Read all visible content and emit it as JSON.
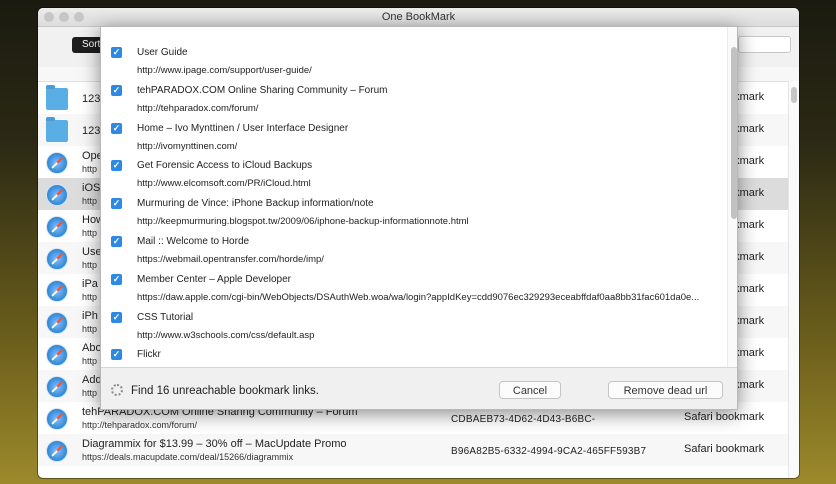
{
  "window": {
    "title": "One BookMark"
  },
  "toolbar": {
    "sort_label": "Sort",
    "search_placeholder": ""
  },
  "background_rows": [
    {
      "icon": "folder-icon",
      "title": "123",
      "url": "",
      "guid": "",
      "type": "Safari bookmark"
    },
    {
      "icon": "folder-icon",
      "title": "123",
      "url": "",
      "guid": "",
      "type": "Safari bookmark"
    },
    {
      "icon": "safari-icon",
      "title": "Ope",
      "url": "http",
      "guid": "",
      "type": "Safari bookmark"
    },
    {
      "icon": "safari-icon",
      "title": "iOS",
      "url": "http",
      "guid": "",
      "type": "Safari bookmark"
    },
    {
      "icon": "safari-icon",
      "title": "How",
      "url": "http",
      "guid": "",
      "type": "Safari bookmark"
    },
    {
      "icon": "safari-icon",
      "title": "Use",
      "url": "http",
      "guid": "",
      "type": "Safari bookmark"
    },
    {
      "icon": "safari-icon",
      "title": "iPa",
      "url": "http",
      "guid": "",
      "type": "Safari bookmark"
    },
    {
      "icon": "safari-icon",
      "title": "iPh",
      "url": "http",
      "guid": "",
      "type": "Safari bookmark"
    },
    {
      "icon": "safari-icon",
      "title": "Abo",
      "url": "http",
      "guid": "",
      "type": "Safari bookmark"
    },
    {
      "icon": "safari-icon",
      "title": "Add",
      "url": "http",
      "guid": "",
      "type": "Safari bookmark"
    },
    {
      "icon": "safari-icon",
      "title": "tehPARADOX.COM Online Sharing Community – Forum",
      "url": "http://tehparadox.com/forum/",
      "guid": "CDBAEB73-4D62-4D43-B6BC-",
      "type": "Safari bookmark"
    },
    {
      "icon": "safari-icon",
      "title": "Diagrammix for $13.99 – 30% off – MacUpdate Promo",
      "url": "https://deals.macupdate.com/deal/15266/diagrammix",
      "guid": "B96A82B5-6332-4994-9CA2-465FF593B7",
      "type": "Safari bookmark"
    }
  ],
  "dialog": {
    "items": [
      {
        "checked": "✓",
        "title": "User Guide",
        "url": "http://www.ipage.com/support/user-guide/"
      },
      {
        "checked": "✓",
        "title": "tehPARADOX.COM Online Sharing Community – Forum",
        "url": "http://tehparadox.com/forum/"
      },
      {
        "checked": "✓",
        "title": "Home – Ivo Mynttinen / User Interface Designer",
        "url": "http://ivomynttinen.com/"
      },
      {
        "checked": "✓",
        "title": "Get Forensic Access to iCloud Backups",
        "url": "http://www.elcomsoft.com/PR/iCloud.html"
      },
      {
        "checked": "✓",
        "title": "Murmuring de Vince: iPhone Backup information/note",
        "url": "http://keepmurmuring.blogspot.tw/2009/06/iphone-backup-informationnote.html"
      },
      {
        "checked": "✓",
        "title": "Mail :: Welcome to Horde",
        "url": "https://webmail.opentransfer.com/horde/imp/"
      },
      {
        "checked": "✓",
        "title": "Member Center – Apple Developer",
        "url": "https://daw.apple.com/cgi-bin/WebObjects/DSAuthWeb.woa/wa/login?appIdKey=cdd9076ec329293eceabffdaf0aa8bb31fac601da0e..."
      },
      {
        "checked": "✓",
        "title": "CSS Tutorial",
        "url": "http://www.w3schools.com/css/default.asp"
      },
      {
        "checked": "✓",
        "title": "Flickr",
        "url": ""
      }
    ],
    "status": "Find 16 unreachable bookmark links.",
    "cancel_label": "Cancel",
    "remove_label": "Remove dead url"
  }
}
